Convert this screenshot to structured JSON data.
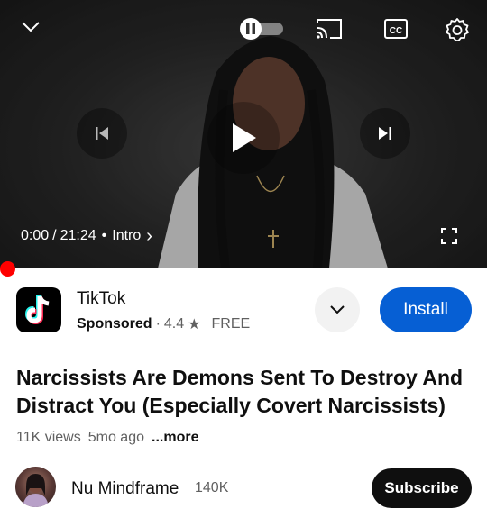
{
  "player": {
    "current_time": "0:00",
    "separator": "/",
    "duration": "21:24",
    "bullet": "•",
    "chapter": "Intro",
    "chapter_chevron": "›",
    "progress_fraction": 0,
    "icons": {
      "collapse": "chevron-down-icon",
      "autoplay": "autoplay-pause-toggle-icon",
      "cast": "cast-icon",
      "captions": "closed-captions-icon",
      "settings": "gear-icon",
      "previous": "skip-previous-icon",
      "play": "play-icon",
      "next": "skip-next-icon",
      "fullscreen": "fullscreen-icon"
    },
    "captions_label": "CC"
  },
  "ad": {
    "app_name": "TikTok",
    "sponsored_label": "Sponsored",
    "bullet": "·",
    "rating": "4.4",
    "star": "★",
    "price": "FREE",
    "install_label": "Install",
    "accent": "#065fd4"
  },
  "video": {
    "title": "Narcissists Are Demons Sent To Destroy And Distract You (Especially Covert Narcissists)",
    "views": "11K views",
    "age": "5mo ago",
    "more_label": "...more"
  },
  "channel": {
    "name": "Nu Mindframe",
    "subscribers": "140K",
    "subscribe_label": "Subscribe"
  }
}
